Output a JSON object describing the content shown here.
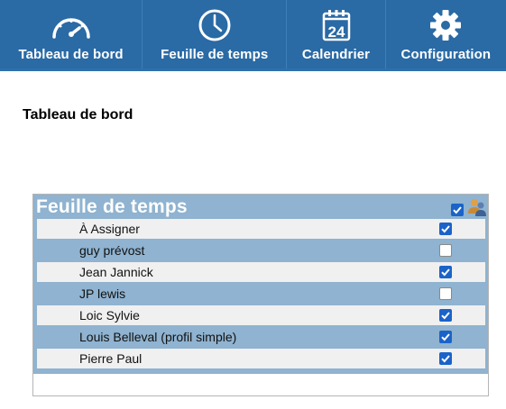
{
  "nav": {
    "items": [
      {
        "id": "tableau",
        "label": "Tableau de bord",
        "icon": "speedometer-icon"
      },
      {
        "id": "feuille",
        "label": "Feuille de temps",
        "icon": "clock-icon"
      },
      {
        "id": "calendrier",
        "label": "Calendrier",
        "icon": "calendar-icon",
        "day": "24"
      },
      {
        "id": "config",
        "label": "Configuration",
        "icon": "gear-icon"
      }
    ]
  },
  "page": {
    "title": "Tableau de bord"
  },
  "panel": {
    "title": "Feuille de temps",
    "select_all_checked": true,
    "users": [
      {
        "name": "À Assigner",
        "checked": true
      },
      {
        "name": "guy prévost",
        "checked": false
      },
      {
        "name": "Jean Jannick",
        "checked": true
      },
      {
        "name": "JP lewis",
        "checked": false
      },
      {
        "name": "Loic Sylvie",
        "checked": true
      },
      {
        "name": "Louis Belleval (profil simple)",
        "checked": true
      },
      {
        "name": "Pierre Paul",
        "checked": true
      }
    ]
  },
  "colors": {
    "topbar": "#2a6aa5",
    "panel": "#8fb3d0",
    "checkbox": "#1a63c9"
  }
}
